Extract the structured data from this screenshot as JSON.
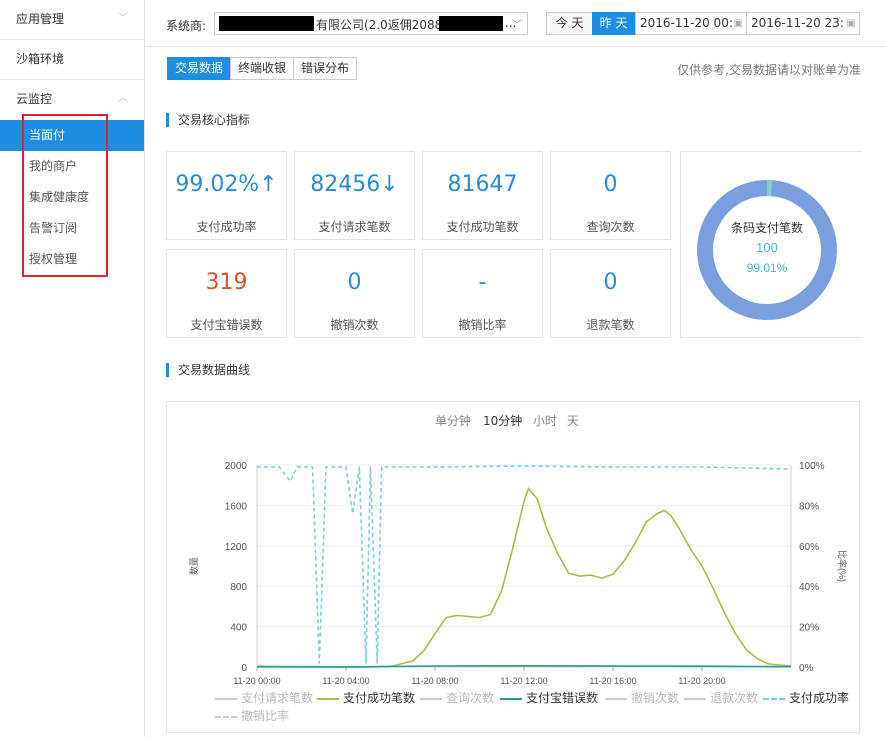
{
  "sidebar": {
    "groups": [
      {
        "label": "应用管理"
      },
      {
        "label": "沙箱环境"
      },
      {
        "label": "云监控"
      }
    ],
    "sub_items": [
      {
        "label": "当面付"
      },
      {
        "label": "我的商户"
      },
      {
        "label": "集成健康度"
      },
      {
        "label": "告警订阅"
      },
      {
        "label": "授权管理"
      }
    ]
  },
  "filter": {
    "system_label": "系统商:",
    "merchant_text": "有限公司(2.0返佣2088",
    "merchant_suffix": "...",
    "today_label": "今 天",
    "yesterday_label": "昨 天",
    "start_date": "2016-11-20 00:",
    "end_date": "2016-11-20 23:"
  },
  "tabs": [
    "交易数据",
    "终端收银",
    "错误分布"
  ],
  "note": "仅供参考,交易数据请以对账单为准",
  "kpi_section_title": "交易核心指标",
  "kpis": [
    {
      "value": "99.02%↑",
      "label": "支付成功率"
    },
    {
      "value": "82456↓",
      "label": "支付请求笔数"
    },
    {
      "value": "81647",
      "label": "支付成功笔数"
    },
    {
      "value": "0",
      "label": "查询次数"
    },
    {
      "value": "319",
      "label": "支付宝错误数"
    },
    {
      "value": "0",
      "label": "撤销次数"
    },
    {
      "value": "-",
      "label": "撤销比率"
    },
    {
      "value": "0",
      "label": "退款笔数"
    }
  ],
  "donut": {
    "title": "条码支付笔数",
    "count": "100",
    "percent": "99.01%",
    "fraction": 0.9901,
    "main_color": "#7a9fde",
    "small_color": "#7fd0c8"
  },
  "curve_section_title": "交易数据曲线",
  "granularity": [
    "单分钟",
    "10分钟",
    "小时",
    "天"
  ],
  "chart_data": {
    "type": "line",
    "y_left_label": "数量",
    "y_right_label": "比率(%)",
    "y_left_ticks": [
      "2000",
      "1600",
      "1200",
      "800",
      "400",
      "0"
    ],
    "y_left_range": [
      0,
      2000
    ],
    "y_right_ticks": [
      "100%",
      "80%",
      "60%",
      "40%",
      "20%",
      "0%"
    ],
    "y_right_range": [
      0,
      100
    ],
    "x_ticks": [
      "11-20 00:00",
      "11-20 04:00",
      "11-20 08:00",
      "11-20 12:00",
      "11-20 16:00",
      "11-20 20:00"
    ],
    "x_range_hours": [
      0,
      24
    ],
    "series": [
      {
        "name": "支付成功笔数",
        "color": "#a9bd45",
        "points": [
          [
            0,
            8
          ],
          [
            1,
            5
          ],
          [
            2,
            3
          ],
          [
            3,
            2
          ],
          [
            4,
            1
          ],
          [
            5,
            1
          ],
          [
            6,
            5
          ],
          [
            7,
            60
          ],
          [
            7.5,
            160
          ],
          [
            8,
            330
          ],
          [
            8.5,
            490
          ],
          [
            9,
            510
          ],
          [
            9.5,
            500
          ],
          [
            10,
            490
          ],
          [
            10.5,
            520
          ],
          [
            11,
            760
          ],
          [
            11.5,
            1180
          ],
          [
            12,
            1640
          ],
          [
            12.2,
            1770
          ],
          [
            12.6,
            1660
          ],
          [
            13,
            1380
          ],
          [
            13.5,
            1130
          ],
          [
            14,
            930
          ],
          [
            14.5,
            900
          ],
          [
            15,
            910
          ],
          [
            15.5,
            880
          ],
          [
            16,
            920
          ],
          [
            16.5,
            1050
          ],
          [
            17,
            1230
          ],
          [
            17.5,
            1440
          ],
          [
            18,
            1520
          ],
          [
            18.3,
            1550
          ],
          [
            18.6,
            1500
          ],
          [
            19,
            1360
          ],
          [
            19.5,
            1160
          ],
          [
            20,
            1000
          ],
          [
            20.5,
            780
          ],
          [
            21,
            540
          ],
          [
            21.5,
            330
          ],
          [
            22,
            170
          ],
          [
            22.5,
            80
          ],
          [
            23,
            30
          ],
          [
            24,
            10
          ]
        ]
      },
      {
        "name": "支付宝错误数",
        "color": "#2a9b8e",
        "points": [
          [
            0,
            2
          ],
          [
            4,
            1
          ],
          [
            8,
            10
          ],
          [
            12,
            12
          ],
          [
            16,
            9
          ],
          [
            20,
            8
          ],
          [
            24,
            3
          ]
        ]
      },
      {
        "name": "支付成功率",
        "color": "#7fd0d8",
        "axis": "right",
        "dashed": true,
        "points": [
          [
            0,
            99
          ],
          [
            1,
            99
          ],
          [
            1.5,
            92
          ],
          [
            1.8,
            99
          ],
          [
            2.5,
            99
          ],
          [
            2.8,
            2
          ],
          [
            3.1,
            99
          ],
          [
            4,
            99
          ],
          [
            4.3,
            76
          ],
          [
            4.6,
            99
          ],
          [
            4.9,
            2
          ],
          [
            5.1,
            99
          ],
          [
            5.4,
            2
          ],
          [
            5.6,
            99
          ],
          [
            8,
            99
          ],
          [
            12,
            99.5
          ],
          [
            16,
            99
          ],
          [
            20,
            99
          ],
          [
            24,
            98
          ]
        ]
      }
    ],
    "legend": [
      {
        "name": "支付请求笔数",
        "active": false,
        "color": "#cccccc"
      },
      {
        "name": "支付成功笔数",
        "active": true,
        "color": "#a9bd45"
      },
      {
        "name": "查询次数",
        "active": false,
        "color": "#cccccc"
      },
      {
        "name": "支付宝错误数",
        "active": true,
        "color": "#2a9b8e"
      },
      {
        "name": "撤销次数",
        "active": false,
        "color": "#cccccc"
      },
      {
        "name": "退款次数",
        "active": false,
        "color": "#cccccc"
      },
      {
        "name": "支付成功率",
        "active": true,
        "color": "#7fd0d8",
        "dashed": true
      },
      {
        "name": "撤销比率",
        "active": false,
        "color": "#cccccc",
        "dashed": true
      }
    ]
  }
}
